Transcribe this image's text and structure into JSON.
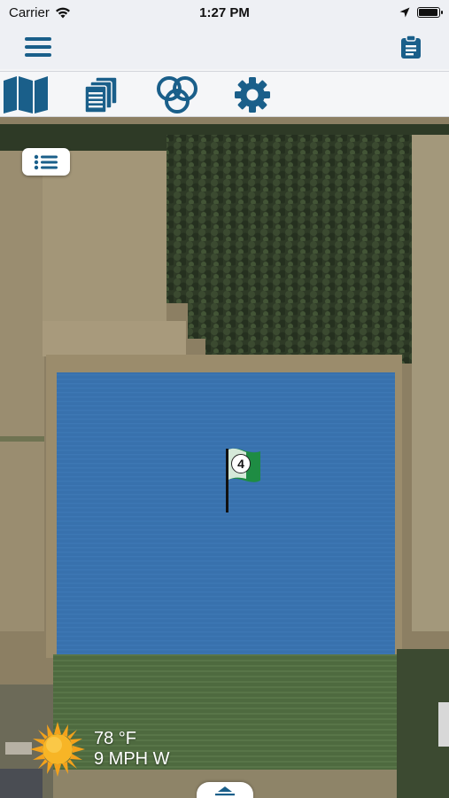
{
  "status_bar": {
    "carrier": "Carrier",
    "time": "1:27 PM",
    "battery_level": 0.95,
    "icons": [
      "wifi-icon",
      "location-arrow-icon",
      "battery-icon"
    ]
  },
  "nav_bar": {
    "menu_icon": "hamburger-menu-icon",
    "right_icon": "clipboard-icon"
  },
  "tabs": [
    {
      "id": "map",
      "icon": "map-icon",
      "active": true
    },
    {
      "id": "layers",
      "icon": "stacked-pages-icon"
    },
    {
      "id": "overlap",
      "icon": "three-rings-icon"
    },
    {
      "id": "settings",
      "icon": "gear-icon"
    }
  ],
  "map": {
    "field_marker_number": "4",
    "legend_icon": "list-icon"
  },
  "weather": {
    "temperature": "78 °F",
    "wind": "9 MPH W",
    "icon": "sun-icon"
  },
  "colors": {
    "accent": "#1a5f8a",
    "field_overlay": "#2f6fb3",
    "flag_green": "#1e8c43"
  }
}
